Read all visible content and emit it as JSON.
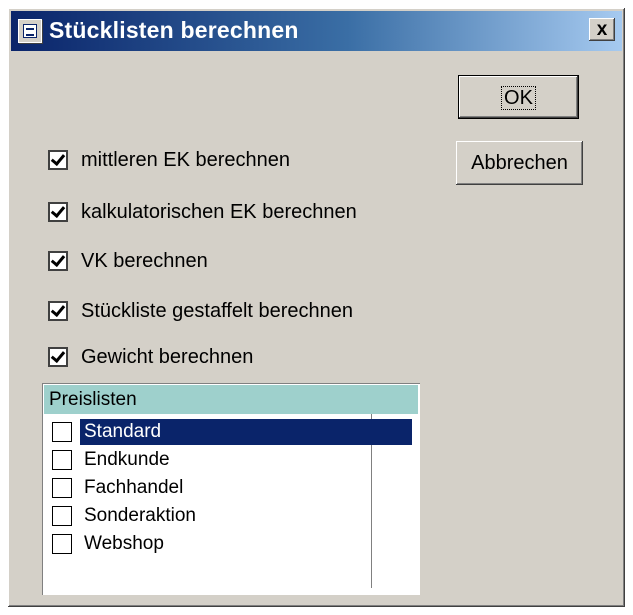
{
  "window": {
    "title": "Stücklisten berechnen",
    "close_label": "x",
    "icon": "window-icon"
  },
  "buttons": {
    "ok_label": "OK",
    "cancel_label": "Abbrechen"
  },
  "options": [
    {
      "label": "mittleren EK berechnen",
      "checked": true
    },
    {
      "label": "kalkulatorischen EK berechnen",
      "checked": true
    },
    {
      "label": "VK berechnen",
      "checked": true
    },
    {
      "label": "Stückliste gestaffelt berechnen",
      "checked": true
    },
    {
      "label": "Gewicht berechnen",
      "checked": true
    }
  ],
  "pricelists": {
    "header": "Preislisten",
    "items": [
      {
        "label": "Standard",
        "checked": false,
        "selected": true
      },
      {
        "label": "Endkunde",
        "checked": false,
        "selected": false
      },
      {
        "label": "Fachhandel",
        "checked": false,
        "selected": false
      },
      {
        "label": "Sonderaktion",
        "checked": false,
        "selected": false
      },
      {
        "label": "Webshop",
        "checked": false,
        "selected": false
      }
    ]
  },
  "colors": {
    "titlebar": "#0a246a",
    "selection": "#0a246a",
    "list_header": "#9ed0cc",
    "face": "#d4d0c8"
  }
}
